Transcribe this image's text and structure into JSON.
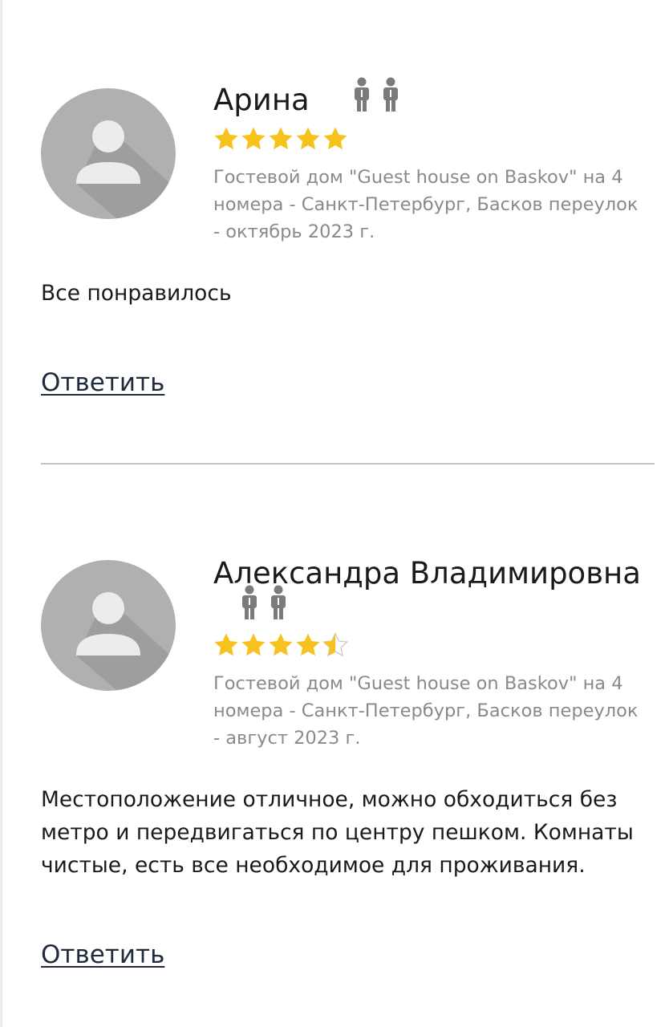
{
  "reviews": [
    {
      "author": "Арина",
      "rating": 5,
      "rating_max": 5,
      "guests_icon": "two-persons-icon",
      "property_text": "Гостевой дом \"Guest house on Baskov\" на 4 номера - Санкт-Петербург, Басков переулок - октябрь 2023 г.",
      "comment": "Все понравилось",
      "reply_label": "Ответить"
    },
    {
      "author": "Александра Владимировна",
      "rating": 4.5,
      "rating_max": 5,
      "guests_icon": "two-persons-icon",
      "property_text": "Гостевой дом \"Guest house on Baskov\" на 4 номера - Санкт-Петербург, Басков переулок - август 2023 г.",
      "comment": "Местоположение отличное, можно обходиться без метро и передвигаться по центру пешком. Комнаты чистые, есть все необходимое для проживания.",
      "reply_label": "Ответить"
    }
  ],
  "colors": {
    "star": "#f7c21b",
    "star_empty_outline": "#c9c9c9",
    "avatar_bg": "#b0b0b0",
    "avatar_shadow": "#9e9e9e",
    "avatar_figure": "#ececec",
    "person_icon": "#7b7b7b",
    "muted_text": "#8a8a8a",
    "link": "#1f2a3d",
    "divider": "#c4c4c4"
  }
}
